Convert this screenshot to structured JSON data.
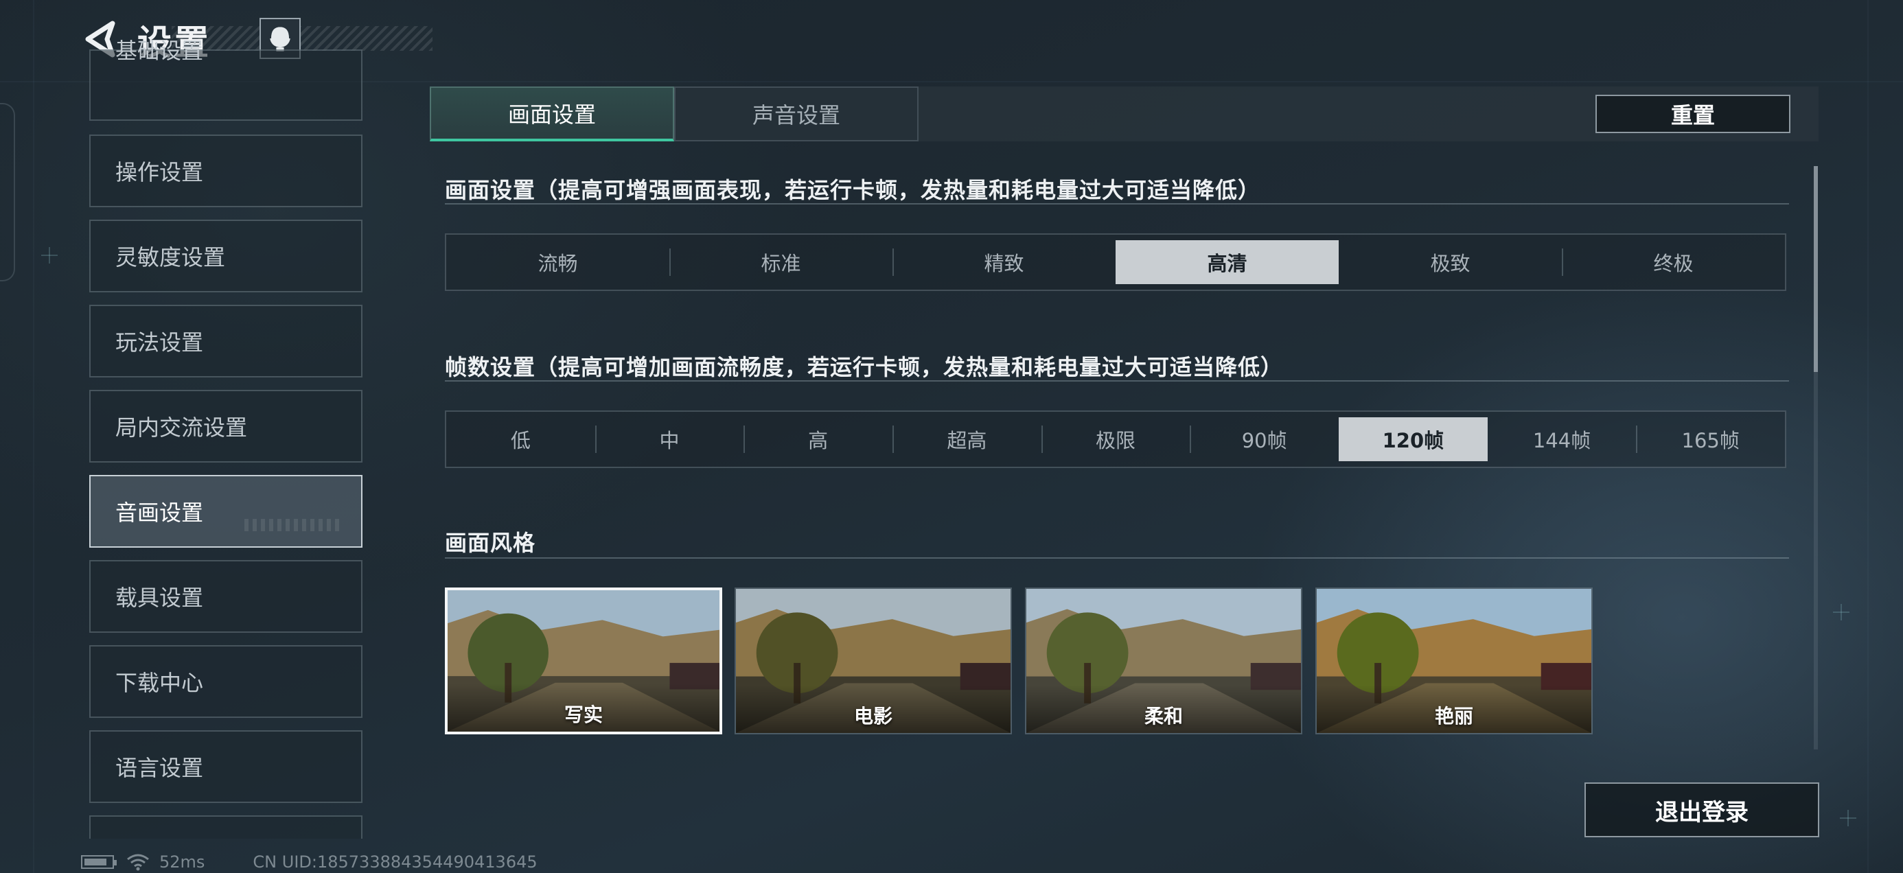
{
  "header": {
    "title": "设置",
    "back_icon": "back-arrow-icon",
    "profile_icon": "headset-profile-icon"
  },
  "sidebar": {
    "items": [
      {
        "label": "基础设置",
        "active": false
      },
      {
        "label": "操作设置",
        "active": false
      },
      {
        "label": "灵敏度设置",
        "active": false
      },
      {
        "label": "玩法设置",
        "active": false
      },
      {
        "label": "局内交流设置",
        "active": false
      },
      {
        "label": "音画设置",
        "active": true
      },
      {
        "label": "载具设置",
        "active": false
      },
      {
        "label": "下载中心",
        "active": false
      },
      {
        "label": "语言设置",
        "active": false
      },
      {
        "label": "",
        "active": false
      }
    ]
  },
  "tabs": [
    {
      "label": "画面设置",
      "active": true
    },
    {
      "label": "声音设置",
      "active": false
    }
  ],
  "reset_label": "重置",
  "quality": {
    "title": "画面设置（提高可增强画面表现，若运行卡顿，发热量和耗电量过大可适当降低）",
    "options": [
      "流畅",
      "标准",
      "精致",
      "高清",
      "极致",
      "终极"
    ],
    "selected": "高清"
  },
  "framerate": {
    "title": "帧数设置（提高可增加画面流畅度，若运行卡顿，发热量和耗电量过大可适当降低）",
    "options": [
      "低",
      "中",
      "高",
      "超高",
      "极限",
      "90帧",
      "120帧",
      "144帧",
      "165帧"
    ],
    "selected": "120帧"
  },
  "style": {
    "title": "画面风格",
    "options": [
      {
        "label": "写实",
        "selected": true
      },
      {
        "label": "电影",
        "selected": false
      },
      {
        "label": "柔和",
        "selected": false
      },
      {
        "label": "艳丽",
        "selected": false
      }
    ]
  },
  "logout_label": "退出登录",
  "status": {
    "ping": "52ms",
    "uid": "CN UID:18573388435449041364​5"
  },
  "colors": {
    "accent": "#3fc6a0",
    "selected_option_bg": "#c9ced2",
    "background": "#1f2b34"
  }
}
